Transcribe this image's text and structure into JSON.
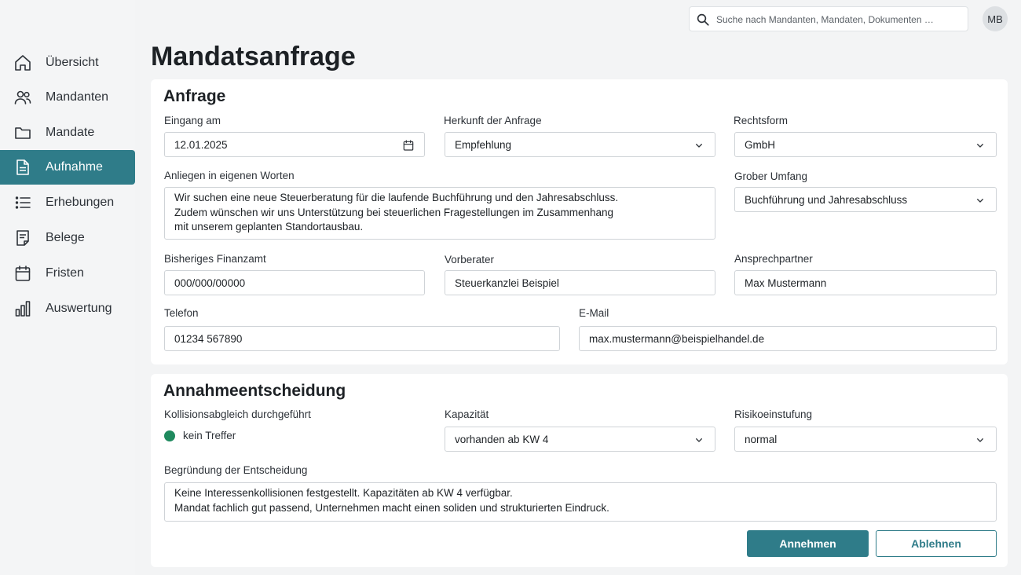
{
  "app": {
    "user_initials": "MB"
  },
  "search": {
    "placeholder": "Suche nach Mandanten, Mandaten, Dokumenten …"
  },
  "sidebar": {
    "items": [
      {
        "label": "Übersicht",
        "icon": "home-icon",
        "active": false
      },
      {
        "label": "Mandanten",
        "icon": "users-icon",
        "active": false
      },
      {
        "label": "Mandate",
        "icon": "folder-icon",
        "active": false
      },
      {
        "label": "Aufnahme",
        "icon": "document-icon",
        "active": true
      },
      {
        "label": "Erhebungen",
        "icon": "list-icon",
        "active": false
      },
      {
        "label": "Belege",
        "icon": "receipt-icon",
        "active": false
      },
      {
        "label": "Fristen",
        "icon": "calendar-icon",
        "active": false
      },
      {
        "label": "Auswertung",
        "icon": "bar-chart-icon",
        "active": false
      }
    ]
  },
  "page": {
    "title": "Mandatsanfrage"
  },
  "anfrage": {
    "title": "Anfrage",
    "eingang": {
      "label": "Eingang am",
      "value": "12.01.2025"
    },
    "herkunft": {
      "label": "Herkunft der Anfrage",
      "value": "Empfehlung"
    },
    "rechtsform": {
      "label": "Rechtsform",
      "value": "GmbH"
    },
    "anliegen": {
      "label": "Anliegen in eigenen Worten",
      "value": "Wir suchen eine neue Steuerberatung für die laufende Buchführung und den Jahresabschluss.\nZudem wünschen wir uns Unterstützung bei steuerlichen Fragestellungen im Zusammenhang\nmit unserem geplanten Standortausbau."
    },
    "umfang": {
      "label": "Grober Umfang",
      "value": "Buchführung und Jahresabschluss"
    },
    "finanzamt": {
      "label": "Bisheriges Finanzamt",
      "value": "000/000/00000"
    },
    "vorberater": {
      "label": "Vorberater",
      "value": "Steuerkanzlei Beispiel"
    },
    "ansprechpartner": {
      "label": "Ansprechpartner",
      "value": "Max Mustermann"
    },
    "telefon": {
      "label": "Telefon",
      "value": "01234 567890"
    },
    "email": {
      "label": "E-Mail",
      "value": "max.mustermann@beispielhandel.de"
    }
  },
  "entscheidung": {
    "title": "Annahmeentscheidung",
    "kollision": {
      "label": "Kollisionsabgleich durchgeführt",
      "status": "kein Treffer",
      "status_color": "#1f8a5e"
    },
    "kapazitaet": {
      "label": "Kapazität",
      "value": "vorhanden ab KW 4"
    },
    "risiko": {
      "label": "Risikoeinstufung",
      "value": "normal"
    },
    "begruendung": {
      "label": "Begründung der Entscheidung",
      "value": "Keine Interessenkollisionen festgestellt. Kapazitäten ab KW 4 verfügbar.\nMandat fachlich gut passend, Unternehmen macht einen soliden und strukturierten Eindruck."
    },
    "accept_label": "Annehmen",
    "reject_label": "Ablehnen"
  },
  "colors": {
    "accent": "#2f7c89",
    "success": "#1f8a5e"
  }
}
